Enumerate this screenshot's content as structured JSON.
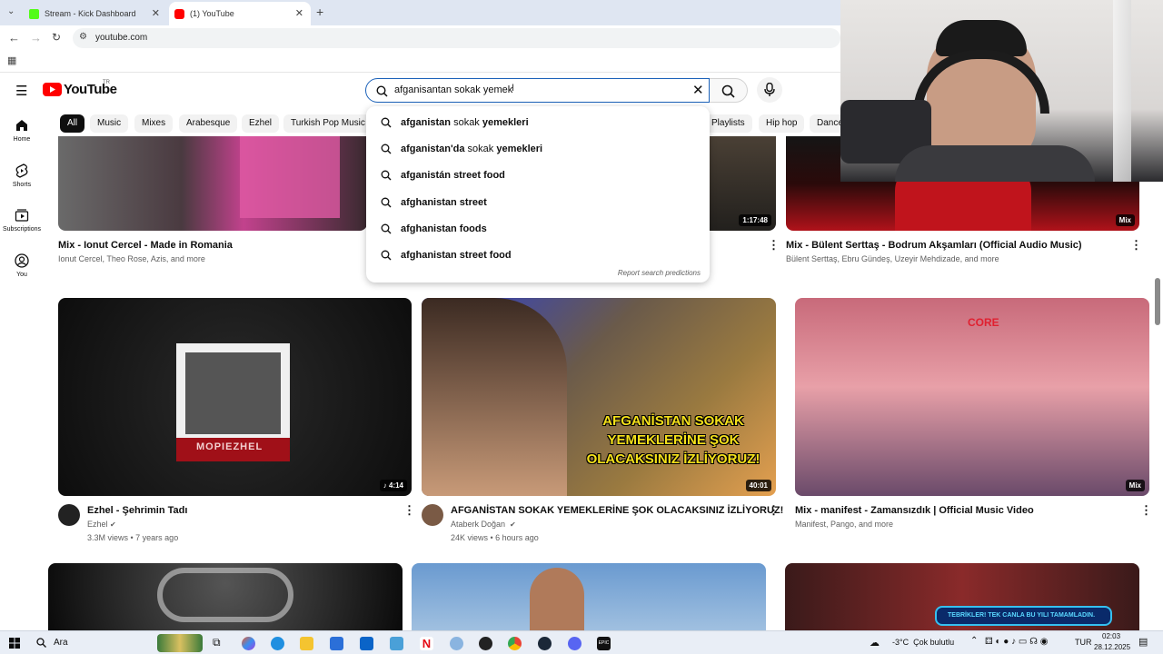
{
  "browser": {
    "tabs": [
      {
        "title": "Stream - Kick Dashboard",
        "color": "#53fc18"
      },
      {
        "title": "(1) YouTube",
        "color": "#ff0000"
      }
    ],
    "url": "youtube.com"
  },
  "header": {
    "logo_text": "YouTube",
    "region": "TR",
    "search_value": "afganisantan sokak yemek"
  },
  "chips": [
    "All",
    "Music",
    "Mixes",
    "Arabesque",
    "Ezhel",
    "Turkish Pop Music",
    "Playlists",
    "Hip hop",
    "Dance"
  ],
  "sidenav": [
    {
      "label": "Home",
      "icon": "home-icon"
    },
    {
      "label": "Shorts",
      "icon": "shorts-icon"
    },
    {
      "label": "Subscriptions",
      "icon": "subscriptions-icon"
    },
    {
      "label": "You",
      "icon": "you-icon"
    }
  ],
  "suggestions": [
    {
      "typed": "afganistan",
      "rest": " sokak ",
      "bold2": "yemekleri"
    },
    {
      "typed": "afganistan'da",
      "rest": " sokak ",
      "bold2": "yemekleri"
    },
    {
      "typed": "afganistán street food",
      "rest": "",
      "bold2": ""
    },
    {
      "typed": "afghanistan street",
      "rest": "",
      "bold2": ""
    },
    {
      "typed": "afghanistan foods",
      "rest": "",
      "bold2": ""
    },
    {
      "typed": "afghanistan street food",
      "rest": "",
      "bold2": ""
    }
  ],
  "report_text": "Report search predictions",
  "videos_row1": [
    {
      "title": "Mix - Ionut Cercel - Made in Romania",
      "meta": "Ionut Cercel, Theo Rose, Azis, and more"
    },
    {
      "duration": "1:17:48"
    },
    {
      "title": "Mix - Bülent Serttaş - Bodrum Akşamları (Official Audio Music)",
      "meta": "Bülent Serttaş, Ebru Gündeş, Uzeyir Mehdizade, and more",
      "badge": "Mix"
    }
  ],
  "videos_row2": [
    {
      "title": "Ezhel - Şehrimin Tadı",
      "channel": "Ezhel",
      "stats": "3.3M views • 7 years ago",
      "duration": "♪ 4:14",
      "thumb_text": "MOPIEZHEL"
    },
    {
      "title": "AFGANİSTAN SOKAK YEMEKLERİNE ŞOK OLACAKSINIZ İZLİYORUZ!",
      "channel": "Ataberk Doğan",
      "stats": "24K views • 6 hours ago",
      "duration": "40:01",
      "thumb_text": "AFGANİSTAN SOKAK YEMEKLERİNE ŞOK OLACAKSINIZ İZLİYORUZ!"
    },
    {
      "title": "Mix - manifest - Zamansızdık | Official Music Video",
      "meta": "Manifest, Pango, and more",
      "badge": "Mix",
      "thumb_text": "CORE"
    }
  ],
  "row3_banner": "TEBRİKLER! TEK CANLA BU YILI TAMAMLADIN.",
  "taskbar": {
    "search": "Ara",
    "weather": "-3°C  Çok bulutlu",
    "lang": "TUR",
    "time": "02:03",
    "date": "28.12.2025"
  }
}
